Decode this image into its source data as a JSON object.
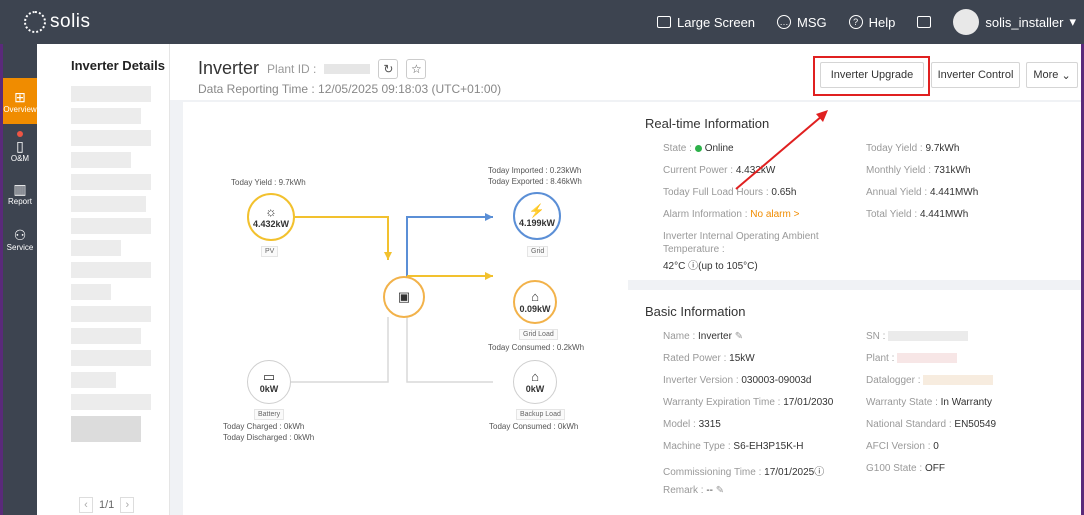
{
  "topbar": {
    "logo_text": "solis",
    "large_screen": "Large Screen",
    "msg": "MSG",
    "help": "Help",
    "user": "solis_installer"
  },
  "nav": [
    {
      "label": "Overview",
      "icon": "overview-icon"
    },
    {
      "label": "O&M",
      "icon": "om-icon"
    },
    {
      "label": "Report",
      "icon": "report-icon"
    },
    {
      "label": "Service",
      "icon": "service-icon"
    }
  ],
  "list": {
    "title": "Inverter Details",
    "pager": "1/1"
  },
  "header": {
    "title": "Inverter",
    "plant_id_label": "Plant ID :",
    "reporting_time": "Data Reporting Time : 12/05/2025 09:18:03 (UTC+01:00)",
    "btn_upgrade": "Inverter Upgrade",
    "btn_control": "Inverter Control",
    "btn_more": "More"
  },
  "flow": {
    "pv": {
      "value": "4.432kW",
      "tag": "PV",
      "yield": "Today Yield : 9.7kWh"
    },
    "grid": {
      "value": "4.199kW",
      "tag": "Grid",
      "imported": "Today Imported : 0.23kWh",
      "exported": "Today Exported : 8.46kWh"
    },
    "grid_load": {
      "value": "0.09kW",
      "tag": "Grid Load",
      "consumed": "Today Consumed : 0.2kWh"
    },
    "battery": {
      "value": "0kW",
      "tag": "Battery",
      "charged": "Today Charged : 0kWh",
      "discharged": "Today Discharged : 0kWh"
    },
    "backup_load": {
      "value": "0kW",
      "tag": "Backup Load",
      "consumed": "Today Consumed : 0kWh"
    }
  },
  "realtime": {
    "title": "Real-time Information",
    "state_label": "State :",
    "state_value": "Online",
    "current_power_label": "Current Power :",
    "current_power": "4.432kW",
    "full_load_label": "Today Full Load Hours :",
    "full_load": "0.65h",
    "alarm_label": "Alarm Information :",
    "alarm": "No alarm >",
    "temp_label_1": "Inverter Internal Operating Ambient",
    "temp_label_2": "Temperature :",
    "temp_value": "42°C ⓘ(up to 105°C)",
    "today_yield_label": "Today Yield :",
    "today_yield": "9.7kWh",
    "monthly_yield_label": "Monthly Yield :",
    "monthly_yield": "731kWh",
    "annual_yield_label": "Annual Yield :",
    "annual_yield": "4.441MWh",
    "total_yield_label": "Total Yield :",
    "total_yield": "4.441MWh"
  },
  "basic": {
    "title": "Basic Information",
    "name_label": "Name :",
    "name": "Inverter",
    "rated_label": "Rated Power :",
    "rated": "15kW",
    "version_label": "Inverter Version :",
    "version": "030003-09003d",
    "warranty_exp_label": "Warranty Expiration Time :",
    "warranty_exp": "17/01/2030",
    "model_label": "Model :",
    "model": "3315",
    "machine_label": "Machine Type :",
    "machine": "S6-EH3P15K-H",
    "commission_label": "Commissioning Time :",
    "commission": "17/01/2025ⓘ",
    "remark_label": "Remark :",
    "remark": "--",
    "sn_label": "SN :",
    "plant_label": "Plant :",
    "datalogger_label": "Datalogger :",
    "warranty_state_label": "Warranty State :",
    "warranty_state": "In Warranty",
    "national_label": "National Standard :",
    "national": "EN50549",
    "afci_label": "AFCI Version :",
    "afci": "0",
    "g100_label": "G100 State :",
    "g100": "OFF"
  },
  "colors": {
    "accent": "#f08c00",
    "highlight": "#e02020",
    "topbar": "#3d4450",
    "pv": "#f2c12e",
    "grid": "#5b8fd6"
  }
}
